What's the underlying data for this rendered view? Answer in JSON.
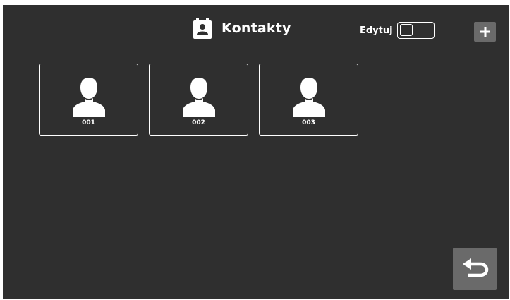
{
  "header": {
    "title": "Kontakty",
    "icon": "contacts-book-icon"
  },
  "edit_toggle": {
    "label": "Edytuj",
    "state": "off"
  },
  "toolbar": {
    "add_icon": "plus-icon",
    "back_icon": "return-arrow-icon"
  },
  "contacts": [
    {
      "label": "001",
      "icon": "person-icon"
    },
    {
      "label": "002",
      "icon": "person-icon"
    },
    {
      "label": "003",
      "icon": "person-icon"
    }
  ],
  "colors": {
    "background": "#2f2f2f",
    "button_bg": "#6a6a6a",
    "foreground": "#ffffff"
  }
}
